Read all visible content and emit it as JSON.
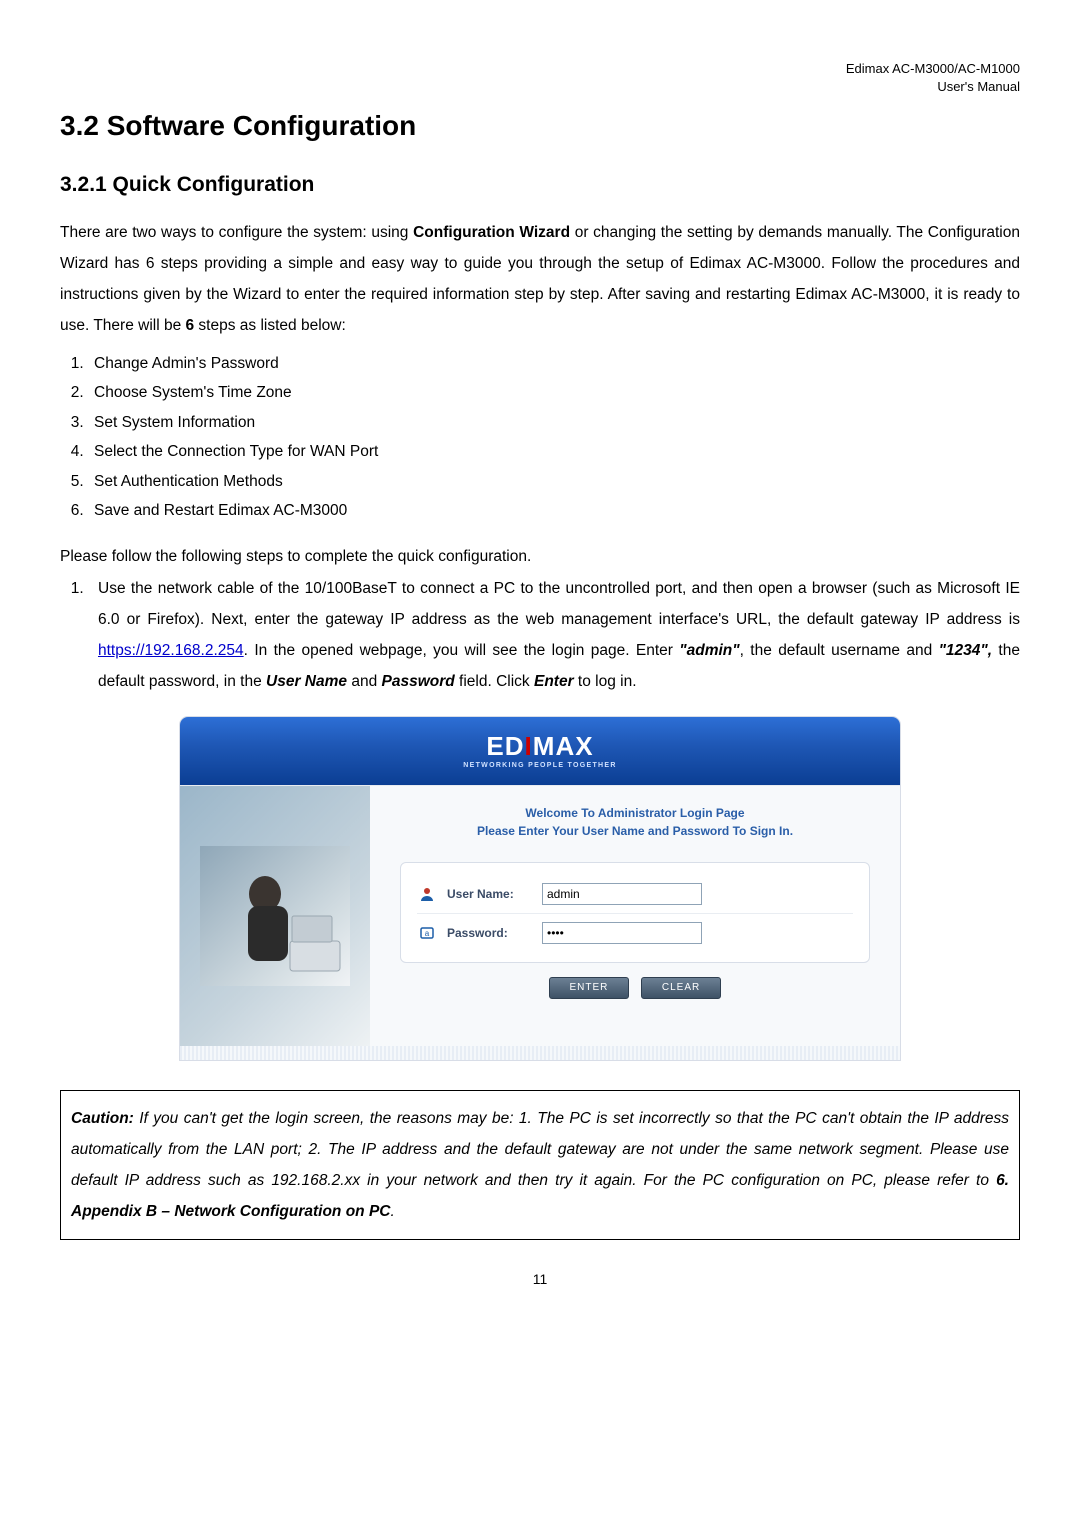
{
  "header": {
    "line1": "Edimax  AC-M3000/AC-M1000",
    "line2": "User's  Manual"
  },
  "section_title": "3.2 Software Configuration",
  "subsection_title": "3.2.1 Quick Configuration",
  "intro_html": "There are two ways to configure the system: using <b>Configuration Wizard</b> or changing the setting by demands manually. The Configuration Wizard has 6 steps providing a simple and easy way to guide you through the setup of Edimax AC-M3000. Follow the procedures and instructions given by the Wizard to enter the required information step by step. After saving and restarting Edimax AC-M3000, it is ready to use. There will be <b>6</b> steps as listed below:",
  "steps": [
    "Change Admin's Password",
    "Choose System's Time Zone",
    "Set System Information",
    "Select the Connection Type for WAN Port",
    "Set Authentication Methods",
    "Save and Restart Edimax AC-M3000"
  ],
  "follow_intro": "Please follow the following steps to complete the quick configuration.",
  "instruction1_pre": "Use the network cable of the 10/100BaseT to connect a PC to the uncontrolled port, and then open a browser (such as Microsoft IE 6.0 or Firefox). Next, enter the gateway IP address as the web management interface's URL, the default gateway IP address is ",
  "instruction1_link_text": "https://192.168.2.254",
  "instruction1_link_href": "https://192.168.2.254",
  "instruction1_post_html": ". In the opened webpage, you will see the login page. Enter <b><i>\"admin\"</i></b>, the default username and <b><i>\"1234\",</i></b> the default password, in the <b><i>User Name</i></b> and <b><i>Password</i></b> field. Click <b><i>Enter</i></b> to log in.",
  "login": {
    "brand": "EDIMAX",
    "brand_tagline": "NETWORKING PEOPLE TOGETHER",
    "welcome_line1": "Welcome To Administrator Login Page",
    "welcome_line2": "Please Enter Your User Name and Password To Sign In.",
    "username_label": "User Name:",
    "username_value": "admin",
    "password_label": "Password:",
    "password_value": "••••",
    "enter_button": "ENTER",
    "clear_button": "CLEAR"
  },
  "caution_html": "<b>Caution:</b> If you can't get the login screen, the reasons may be: 1. The PC is set incorrectly so that the PC can't obtain the IP address automatically from the LAN port; 2. The IP address and the default gateway are not under the same network segment. Please use default IP address such as 192.168.2.xx in your network and then try it again. For the PC configuration on PC, please refer to <b>6. Appendix B – Network Configuration on PC</b>.",
  "page_number": "11"
}
